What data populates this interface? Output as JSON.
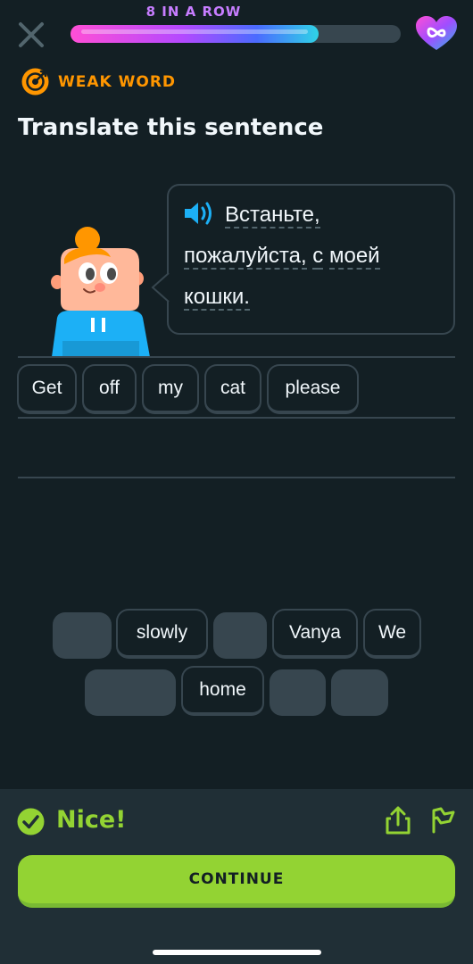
{
  "header": {
    "streak_text": "8 IN A ROW",
    "progress_fraction": 0.75,
    "close_icon": "close-icon",
    "hearts_icon": "infinity-heart-icon"
  },
  "weak_word": {
    "label": "WEAK WORD",
    "icon": "target-icon"
  },
  "title": "Translate this sentence",
  "prompt": {
    "words": [
      "Встаньте,",
      "пожалуйста,",
      "с",
      "моей",
      "кошки."
    ],
    "speaker_icon": "speaker-icon"
  },
  "answer": {
    "selected_words": [
      "Get",
      "off",
      "my",
      "cat",
      "please"
    ]
  },
  "word_bank": {
    "row1": [
      "",
      "slowly",
      "",
      "Vanya",
      "We"
    ],
    "row2": [
      "",
      "home",
      "",
      ""
    ]
  },
  "feedback": {
    "message": "Nice!",
    "continue_label": "CONTINUE",
    "colors": {
      "success": "#93d333",
      "panel": "#202f36"
    }
  },
  "colors": {
    "background": "#131f24",
    "border": "#37464f",
    "weak_word": "#ff9600"
  }
}
